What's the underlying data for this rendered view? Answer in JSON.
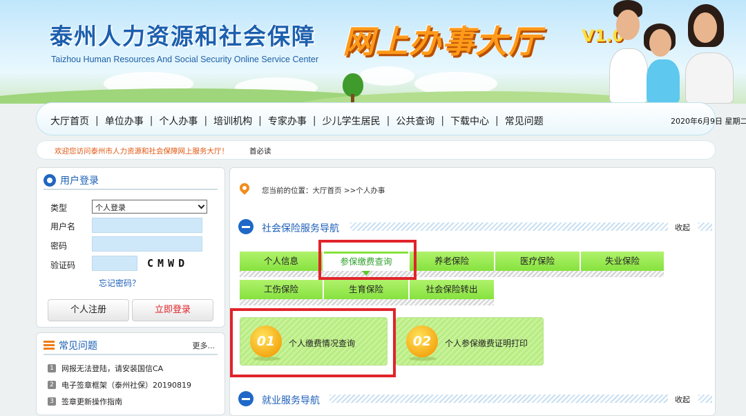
{
  "header": {
    "title_cn": "泰州人力资源和社会保障",
    "title_en": "Taizhou Human Resources And Social Security Online Service Center",
    "title_big": "网上办事大厅",
    "version": "V1.0"
  },
  "nav": {
    "items": [
      "大厅首页",
      "单位办事",
      "个人办事",
      "培训机构",
      "专家办事",
      "少儿学生居民",
      "公共查询",
      "下载中心",
      "常见问题"
    ],
    "separator": "|",
    "date": "2020年6月9日 星期二"
  },
  "notice": {
    "text": "欢迎您访问泰州市人力资源和社会保障网上服务大厅！",
    "read": "首必读"
  },
  "login": {
    "title": "用户登录",
    "type_label": "类型",
    "type_value": "个人登录",
    "username_label": "用户名",
    "password_label": "密码",
    "captcha_label": "验证码",
    "captcha_text": "CMWD",
    "forgot": "忘记密码？",
    "register": "个人注册",
    "submit": "立即登录"
  },
  "faq": {
    "title": "常见问题",
    "more": "更多...",
    "items": [
      {
        "num": "1",
        "text": "网报无法登陆，请安装国信CA"
      },
      {
        "num": "2",
        "text": "电子签章框架（泰州社保）20190819"
      },
      {
        "num": "3",
        "text": "签章更新操作指南"
      }
    ]
  },
  "main": {
    "location": "您当前的位置：大厅首页 >>个人办事",
    "section1": {
      "title": "社会保险服务导航",
      "collapse": "收起"
    },
    "tabs_row1": [
      "个人信息",
      "参保缴费查询",
      "养老保险",
      "医疗保险",
      "失业保险"
    ],
    "tabs_row2": [
      "工伤保险",
      "生育保险",
      "社会保险转出"
    ],
    "cards": [
      {
        "num": "01",
        "text": "个人缴费情况查询"
      },
      {
        "num": "02",
        "text": "个人参保缴费证明打印"
      }
    ],
    "section2": {
      "title": "就业服务导航",
      "collapse": "收起"
    }
  },
  "colors": {
    "accent": "#1d5fb8",
    "tab_green": "#86e23e",
    "highlight": "#e1232a",
    "notice": "#e0560f"
  }
}
